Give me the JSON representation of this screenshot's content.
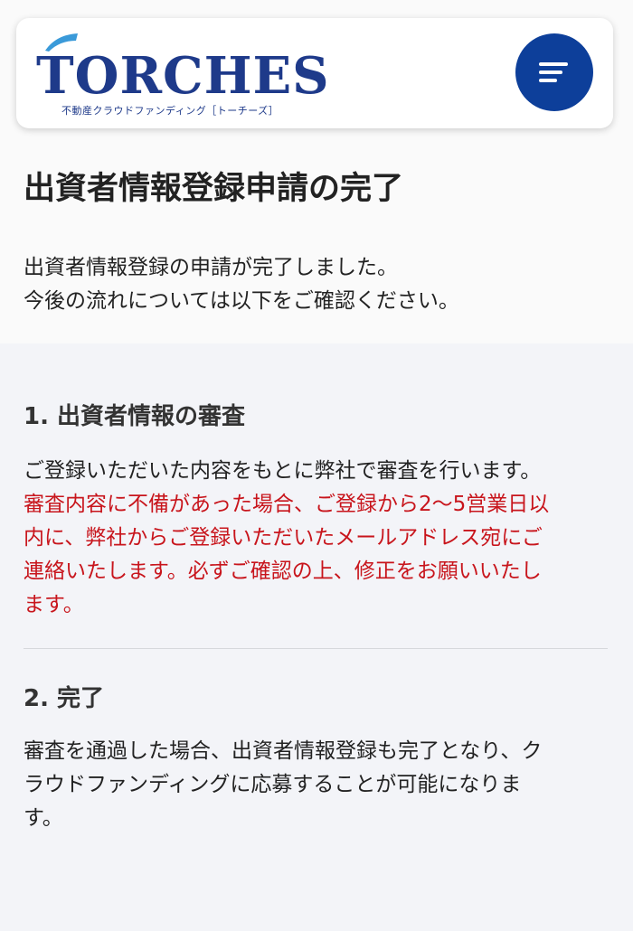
{
  "header": {
    "logo_text": "TORCHES",
    "logo_tagline": "不動産クラウドファンディング［トーチーズ］",
    "menu_icon": "menu-lines-icon",
    "brand_color": "#0d3f9a"
  },
  "page": {
    "title": "出資者情報登録申請の完了",
    "intro": [
      "出資者情報登録の申請が完了しました。",
      "今後の流れについては以下をご確認ください。"
    ]
  },
  "sections": [
    {
      "heading": "1. 出資者情報の審査",
      "lines": [
        "ご登録いただいた内容をもとに弊社で審査を行います。"
      ],
      "warning_lines": [
        "審査内容に不備があった場合、ご登録から2〜5営業日以",
        "内に、弊社からご登録いただいたメールアドレス宛にご",
        "連絡いたします。必ずご確認の上、修正をお願いいたし",
        "ます。"
      ]
    },
    {
      "heading": "2. 完了",
      "lines": [
        "審査を通過した場合、出資者情報登録も完了となり、ク",
        "ラウドファンディングに応募することが可能になりま",
        "す。"
      ]
    }
  ],
  "colors": {
    "warning": "#c8151c",
    "heading": "#333333"
  }
}
